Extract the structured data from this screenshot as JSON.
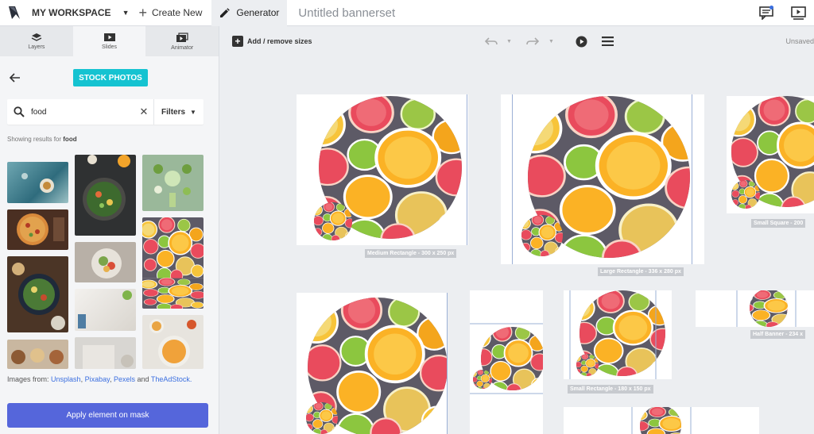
{
  "topbar": {
    "workspace_label": "MY WORKSPACE",
    "create_label": "Create New",
    "generator_label": "Generator",
    "title": "Untitled bannerset"
  },
  "panel": {
    "tabs": [
      {
        "label": "Layers",
        "icon": "layers-icon"
      },
      {
        "label": "Slides",
        "icon": "slides-icon"
      },
      {
        "label": "Animator",
        "icon": "animator-icon"
      }
    ],
    "stock_label": "STOCK PHOTOS",
    "search_value": "food",
    "filters_label": "Filters",
    "results_prefix": "Showing results for",
    "results_term": "food",
    "credits": {
      "prefix": "Images from:",
      "unsplash": "Unsplash",
      "pixabay": "Pixabay",
      "pexels": "Pexels",
      "and": "and",
      "adstock": "TheAdStock."
    },
    "apply_label": "Apply element on mask"
  },
  "toolbar": {
    "add_sizes_label": "Add / remove sizes",
    "unsaved_label": "Unsaved"
  },
  "banners": [
    {
      "label": "Medium Rectangle - 300 x 250 px"
    },
    {
      "label": "Large Rectangle - 336 x 280 px"
    },
    {
      "label": "Small Square - 200"
    },
    {
      "label": "Small Rectangle - 180 x 150 px"
    },
    {
      "label": "Half Banner - 234 x"
    }
  ],
  "colors": {
    "accent_cyan": "#15c3d1",
    "apply_blue": "#5566db",
    "link_blue": "#3b6fe0"
  }
}
